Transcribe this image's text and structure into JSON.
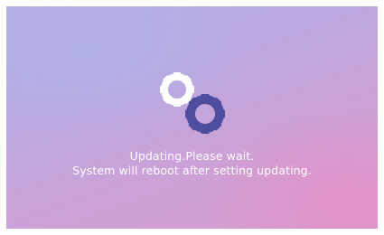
{
  "screen": {
    "status_line_1": "Updating.Please wait.",
    "status_line_2": "System will reboot after setting updating.",
    "icon": "gears-icon"
  },
  "colors": {
    "background_top_left": "#b3b0e6",
    "background_bottom_right": "#d89ccc",
    "gear_light": "#ffffff",
    "gear_dark": "#4f4d9e",
    "text": "#ffffff"
  }
}
